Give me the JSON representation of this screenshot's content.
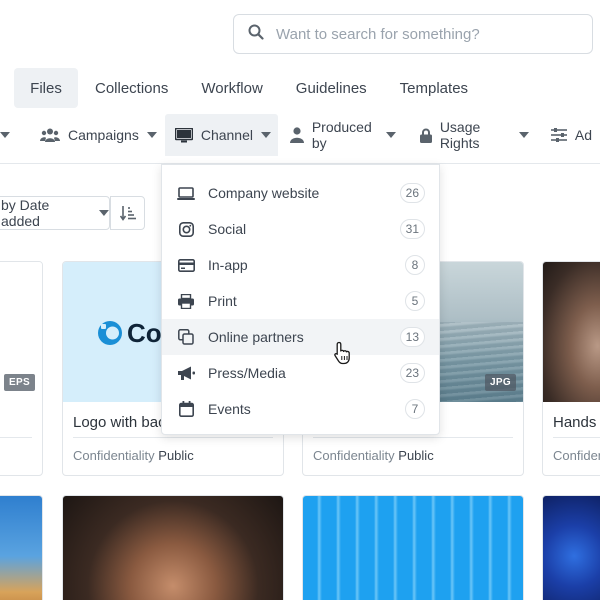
{
  "search": {
    "placeholder": "Want to search for something?"
  },
  "tabs": [
    {
      "label": "Files",
      "active": true
    },
    {
      "label": "Collections"
    },
    {
      "label": "Workflow"
    },
    {
      "label": "Guidelines"
    },
    {
      "label": "Templates"
    }
  ],
  "filters": [
    {
      "label": "Campaigns",
      "icon": "users-icon"
    },
    {
      "label": "Channel",
      "icon": "monitor-icon",
      "active": true
    },
    {
      "label": "Produced by",
      "icon": "user-icon"
    },
    {
      "label": "Usage Rights",
      "icon": "lock-icon"
    },
    {
      "label": "Ad",
      "icon": "sliders-icon"
    }
  ],
  "sort": {
    "label": "by Date added"
  },
  "dropdown": {
    "items": [
      {
        "label": "Company website",
        "count": "26",
        "icon": "laptop-icon"
      },
      {
        "label": "Social",
        "count": "31",
        "icon": "instagram-icon"
      },
      {
        "label": "In-app",
        "count": "8",
        "icon": "card-icon"
      },
      {
        "label": "Print",
        "count": "5",
        "icon": "printer-icon"
      },
      {
        "label": "Online partners",
        "count": "13",
        "icon": "copy-icon",
        "hover": true
      },
      {
        "label": "Press/Media",
        "count": "23",
        "icon": "megaphone-icon"
      },
      {
        "label": "Events",
        "count": "7",
        "icon": "calendar-icon"
      }
    ]
  },
  "cards": [
    {
      "title": "",
      "conf_label": "",
      "conf_value": "",
      "badge": "EPS"
    },
    {
      "title": "Logo with bac",
      "conf_label": "Confidentiality",
      "conf_value": "Public",
      "logo_text": "Co"
    },
    {
      "title": "",
      "conf_label": "Confidentiality",
      "conf_value": "Public",
      "badge": "JPG"
    },
    {
      "title": "Hands",
      "conf_label": "Confiden",
      "conf_value": ""
    }
  ],
  "colors": {
    "accent": "#1a8fd6",
    "text": "#3d4550",
    "muted": "#9aa3ad"
  }
}
